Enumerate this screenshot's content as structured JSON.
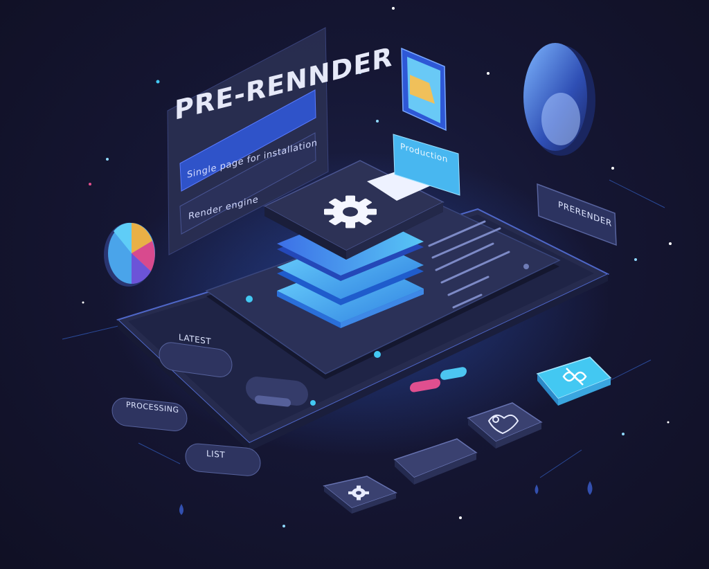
{
  "panel": {
    "title": "PRE-RENNDER",
    "line1": "Single page for installation",
    "line2": "Render engine"
  },
  "tags": {
    "top_right_card": "Production",
    "right_badge": "PRERENDER",
    "left_pill": "LATEST",
    "bottom_pill_1": "PROCESSING",
    "bottom_pill_2": "LIST"
  },
  "colors": {
    "background": "#141530",
    "accent_cyan": "#43c8f2",
    "accent_blue": "#2f5bd8",
    "panel_dark": "#2a2f52"
  },
  "icons": [
    "gear-icon",
    "pie-chart-icon",
    "infinity-icon",
    "heart-link-icon",
    "toggle-icon",
    "gear-small-icon"
  ]
}
